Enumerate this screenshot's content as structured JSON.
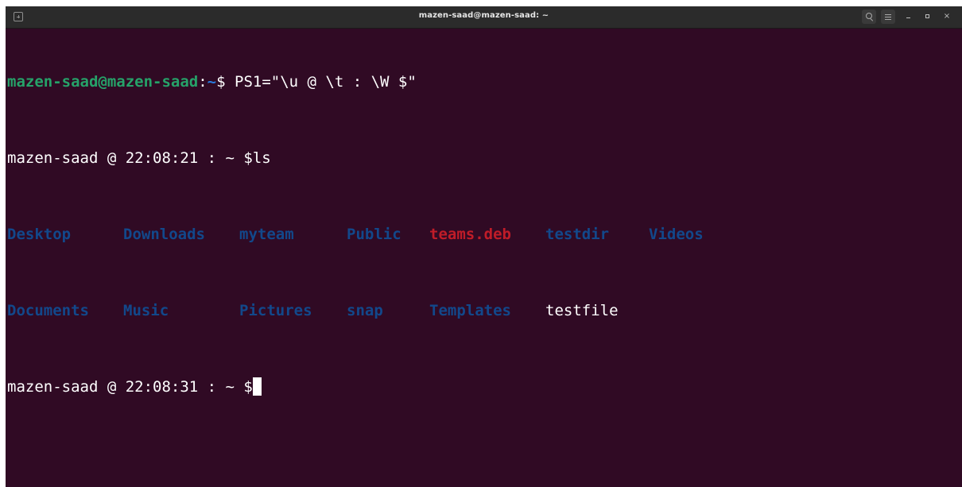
{
  "window": {
    "title": "mazen-saad@mazen-saad: ~",
    "new_tab_icon": "new-tab-icon",
    "search_icon": "search-icon",
    "menu_icon": "hamburger-menu-icon",
    "minimize_icon": "minimize-icon",
    "maximize_icon": "maximize-icon",
    "close_icon": "close-icon",
    "close_glyph": "×"
  },
  "terminal": {
    "line1": {
      "user_host": "mazen-saad@mazen-saad",
      "colon": ":",
      "path": "~",
      "command": "$ PS1=\"\\u @ \\t : \\W $\""
    },
    "line2": {
      "prompt": "mazen-saad @ 22:08:21 : ~ $",
      "command": "ls"
    },
    "ls_output": {
      "row1": [
        "Desktop",
        "Downloads",
        "myteam",
        "Public",
        "teams.deb",
        "testdir",
        "Videos"
      ],
      "row2": [
        "Documents",
        "Music",
        "Pictures",
        "snap",
        "Templates",
        "testfile"
      ]
    },
    "line3": {
      "prompt": "mazen-saad @ 22:08:31 : ~ $"
    }
  },
  "colors": {
    "background": "#300a24",
    "user_host": "#26a269",
    "path": "#2a7bde",
    "directory": "#12488b",
    "archive": "#c01c28",
    "text": "#ffffff"
  }
}
